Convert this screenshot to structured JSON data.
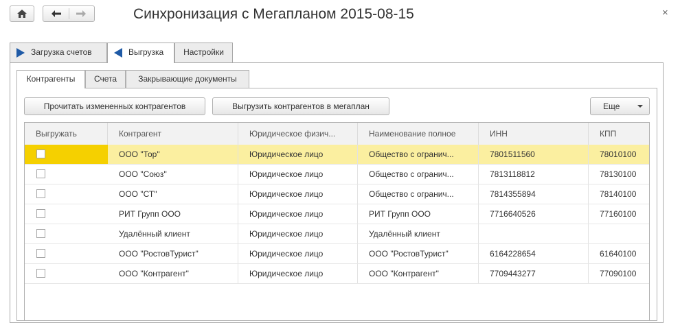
{
  "window": {
    "title": "Синхронизация с Мегапланом 2015-08-15",
    "close_symbol": "×"
  },
  "nav": {
    "home_icon": "home-icon",
    "back_icon": "arrow-left-icon",
    "forward_icon": "arrow-right-icon"
  },
  "top_tabs": [
    {
      "label": "Загрузка счетов",
      "icon": "triangle-right-icon",
      "active": false
    },
    {
      "label": "Выгрузка",
      "icon": "triangle-left-icon",
      "active": true
    },
    {
      "label": "Настройки",
      "active": false
    }
  ],
  "inner_tabs": [
    {
      "label": "Контрагенты",
      "active": true
    },
    {
      "label": "Счета",
      "active": false
    },
    {
      "label": "Закрывающие документы",
      "active": false
    }
  ],
  "toolbar": {
    "read_label": "Прочитать измененных контрагентов",
    "upload_label": "Выгрузить контрагентов в мегаплан",
    "more_label": "Еще"
  },
  "table": {
    "columns": [
      "Выгружать",
      "Контрагент",
      "Юридическое физич...",
      "Наименование полное",
      "ИНН",
      "КПП"
    ],
    "rows": [
      {
        "checked": false,
        "name": "ООО \"Тор\"",
        "type": "Юридическое лицо",
        "full": "Общество с огранич...",
        "inn": "7801511560",
        "kpp": "78010100",
        "selected": true
      },
      {
        "checked": false,
        "name": "ООО \"Союз\"",
        "type": "Юридическое лицо",
        "full": "Общество с огранич...",
        "inn": "7813118812",
        "kpp": "78130100"
      },
      {
        "checked": false,
        "name": "ООО \"СТ\"",
        "type": "Юридическое лицо",
        "full": "Общество с огранич...",
        "inn": "7814355894",
        "kpp": "78140100"
      },
      {
        "checked": false,
        "name": "РИТ Групп ООО",
        "type": "Юридическое лицо",
        "full": "РИТ Групп ООО",
        "inn": "7716640526",
        "kpp": "77160100"
      },
      {
        "checked": false,
        "name": "Удалённый клиент",
        "type": "Юридическое лицо",
        "full": "Удалённый клиент",
        "inn": "",
        "kpp": ""
      },
      {
        "checked": false,
        "name": "ООО \"РостовТурист\"",
        "type": "Юридическое лицо",
        "full": "ООО \"РостовТурист\"",
        "inn": "6164228654",
        "kpp": "61640100"
      },
      {
        "checked": false,
        "name": "ООО \"Контрагент\"",
        "type": "Юридическое лицо",
        "full": "ООО \"Контрагент\"",
        "inn": "7709443277",
        "kpp": "77090100"
      }
    ]
  }
}
